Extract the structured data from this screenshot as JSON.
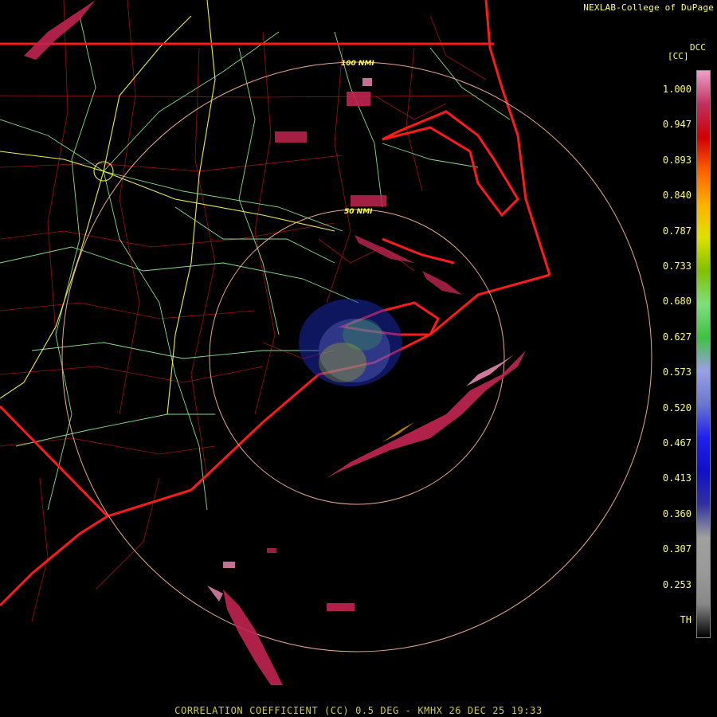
{
  "header": {
    "credit": "NEXLAB-College of DuPage",
    "product_code": "DCC",
    "units": "[CC]"
  },
  "map": {
    "range_rings": [
      "50 NMI",
      "100 NMI"
    ],
    "colors": {
      "background": "#000000",
      "state_borders": "#ff1a1a",
      "county_borders": "#b01010",
      "highways": "#88dd88",
      "interstates": "#eeee44",
      "range_rings": "#e8a890"
    }
  },
  "colorbar": {
    "ticks": [
      "1.000",
      "0.947",
      "0.893",
      "0.840",
      "0.787",
      "0.733",
      "0.680",
      "0.627",
      "0.573",
      "0.520",
      "0.467",
      "0.413",
      "0.360",
      "0.307",
      "0.253",
      "TH"
    ],
    "colors": [
      "#000000",
      "#888888",
      "#9a9a9a",
      "#a0a0a0",
      "#3030a0",
      "#1010c8",
      "#2020ee",
      "#6a78d0",
      "#9aa0e8",
      "#40c040",
      "#7ee07e",
      "#80c000",
      "#e0e000",
      "#ffb000",
      "#ff6000",
      "#d00000",
      "#c03060",
      "#f0a0c8"
    ]
  },
  "footer": {
    "caption": "CORRELATION COEFFICIENT (CC) 0.5 DEG - KMHX 26 DEC 25 19:33"
  }
}
